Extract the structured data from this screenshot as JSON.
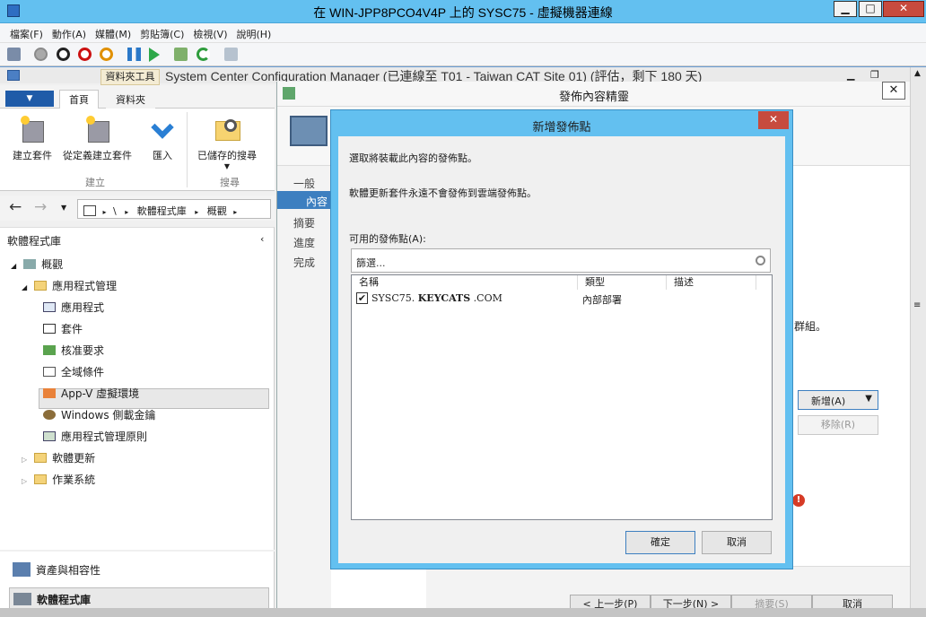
{
  "vm": {
    "title": "在 WIN-JPP8PCO4V4P 上的 SYSC75 - 虛擬機器連線",
    "min": "▁",
    "max": "□",
    "close": "✕",
    "menu": [
      "檔案(F)",
      "動作(A)",
      "媒體(M)",
      "剪貼簿(C)",
      "檢視(V)",
      "說明(H)"
    ]
  },
  "console": {
    "title": "System Center Configuration Manager (已連線至 T01 - Taiwan CAT Site 01) (評估，剩下 180 天)",
    "context_tab": "資料夾工具",
    "ribbon_tabs": [
      "首頁",
      "資料夾"
    ],
    "ribbon_buttons": [
      "建立套件",
      "從定義建立套件",
      "匯入",
      "已儲存的搜尋"
    ],
    "ribbon_groups": [
      "建立",
      "搜尋"
    ],
    "address": [
      "\\",
      "軟體程式庫",
      "概觀"
    ],
    "nav_title": "軟體程式庫",
    "tree": [
      {
        "label": "概觀"
      },
      {
        "label": "應用程式管理"
      },
      {
        "label": "應用程式"
      },
      {
        "label": "套件"
      },
      {
        "label": "核准要求"
      },
      {
        "label": "全域條件"
      },
      {
        "label": "App-V 虛擬環境"
      },
      {
        "label": "Windows 側載金鑰"
      },
      {
        "label": "應用程式管理原則"
      },
      {
        "label": "軟體更新"
      },
      {
        "label": "作業系統"
      }
    ],
    "workspaces": [
      "資產與相容性",
      "軟體程式庫"
    ]
  },
  "wizard": {
    "title": "發佈內容精靈",
    "close": "✕",
    "nav": [
      "一般",
      "內容",
      "摘要",
      "進度",
      "完成"
    ],
    "side_text": "群組。",
    "add_label": "新增(A)",
    "remove_label": "移除(R)",
    "footer_buttons": [
      "< 上一步(P)",
      "下一步(N) >",
      "摘要(S)",
      "取消"
    ]
  },
  "dialog": {
    "title": "新增發佈點",
    "close": "✕",
    "instruction": "選取將裝載此內容的發佈點。",
    "note": "軟體更新套件永遠不會發佈到雲端發佈點。",
    "available_label": "可用的發佈點(A):",
    "filter_placeholder": "篩選...",
    "columns": [
      "名稱",
      "類型",
      "描述"
    ],
    "rows": [
      {
        "name_prefix": "SYSC75.",
        "name_bold": "KEYCATS",
        "name_suffix": ".COM",
        "type": "內部部署",
        "checked": true
      }
    ],
    "ok": "確定",
    "cancel": "取消"
  },
  "colors": {
    "accent": "#63c0f0",
    "close_red": "#c74b3e",
    "selection": "#cce8ff"
  }
}
